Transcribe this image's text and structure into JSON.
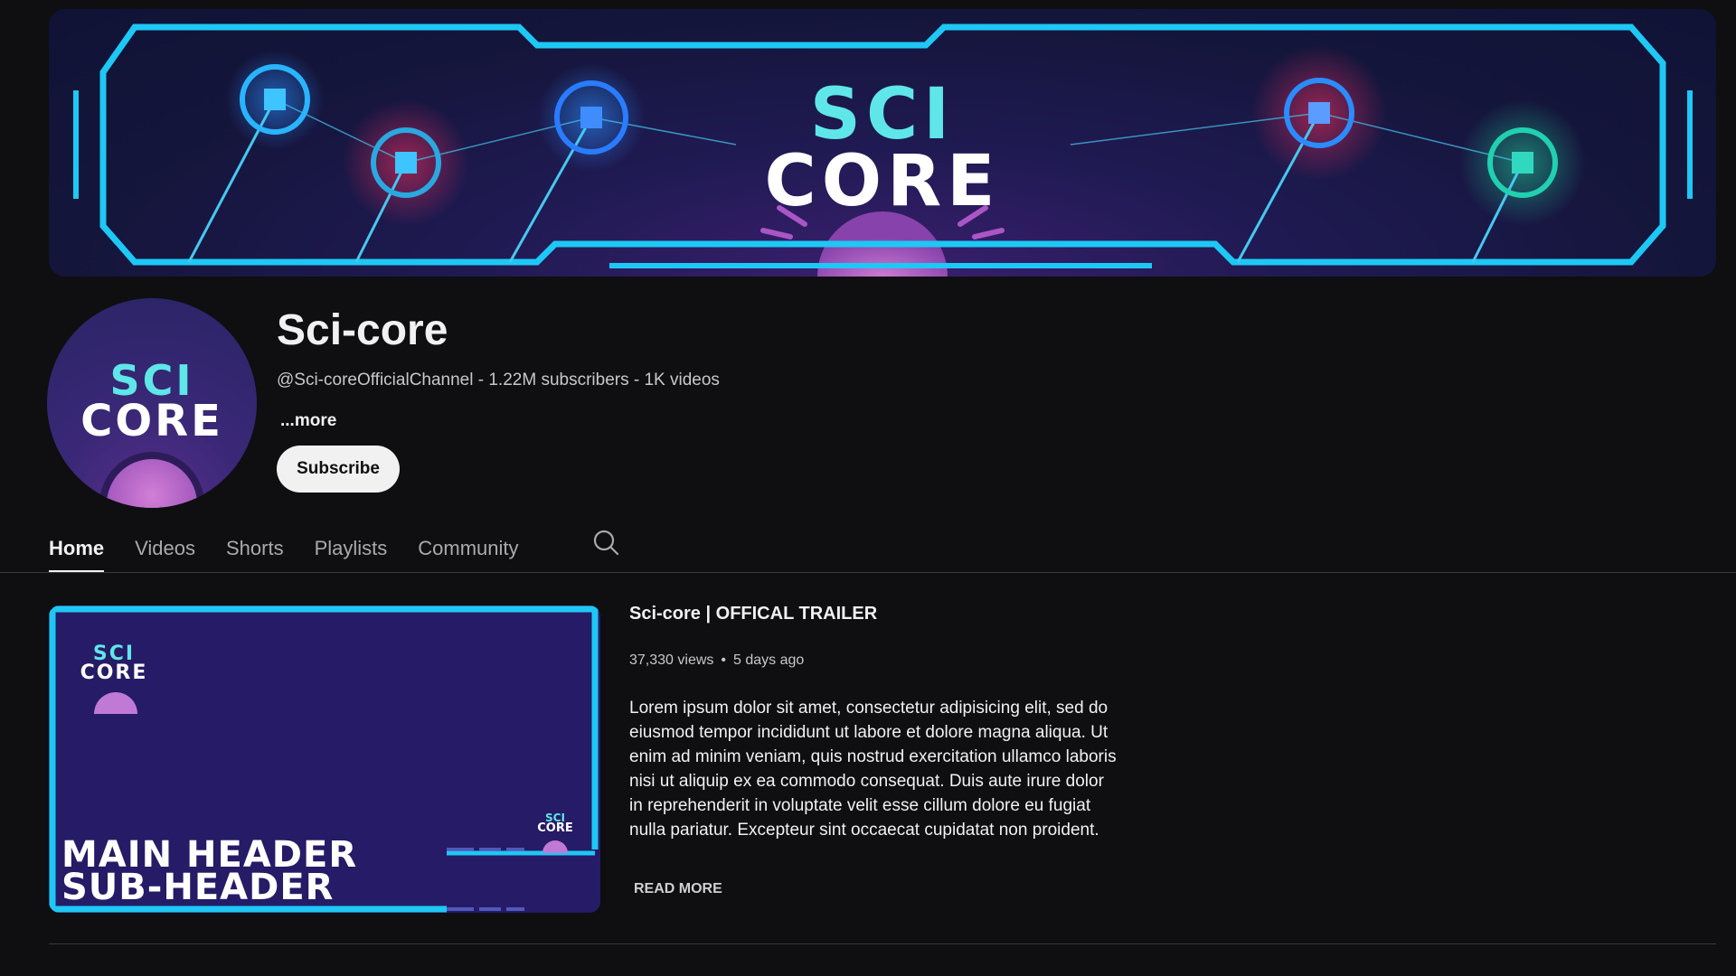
{
  "banner": {
    "logo_line1": "SCI",
    "logo_line2": "CORE",
    "accent_color": "#1ec8f5",
    "glow_color": "#c060d8"
  },
  "avatar": {
    "logo_line1": "SCI",
    "logo_line2": "CORE"
  },
  "channel": {
    "name": "Sci-core",
    "meta": "@Sci-coreOfficialChannel - 1.22M subscribers - 1K videos",
    "more_label": "...more",
    "subscribe_label": "Subscribe"
  },
  "tabs": [
    {
      "label": "Home",
      "active": true
    },
    {
      "label": "Videos",
      "active": false
    },
    {
      "label": "Shorts",
      "active": false
    },
    {
      "label": "Playlists",
      "active": false
    },
    {
      "label": "Community",
      "active": false
    }
  ],
  "search_icon": "search-icon",
  "featured": {
    "thumbnail": {
      "logo_line1": "SCI",
      "logo_line2": "CORE",
      "main_header": "MAIN HEADER",
      "sub_header": "SUB-HEADER"
    },
    "title": "Sci-core | OFFICAL TRAILER",
    "views": "37,330 views",
    "separator": "•",
    "age": "5 days ago",
    "description": "Lorem ipsum dolor sit amet, consectetur adipisicing elit, sed do eiusmod tempor incididunt ut labore et dolore magna aliqua. Ut enim ad minim veniam, quis nostrud exercitation ullamco laboris nisi ut aliquip ex ea commodo consequat. Duis aute irure dolor in reprehenderit in voluptate velit esse cillum dolore eu fugiat nulla pariatur. Excepteur sint occaecat cupidatat non proident.",
    "read_more_label": "READ MORE"
  }
}
